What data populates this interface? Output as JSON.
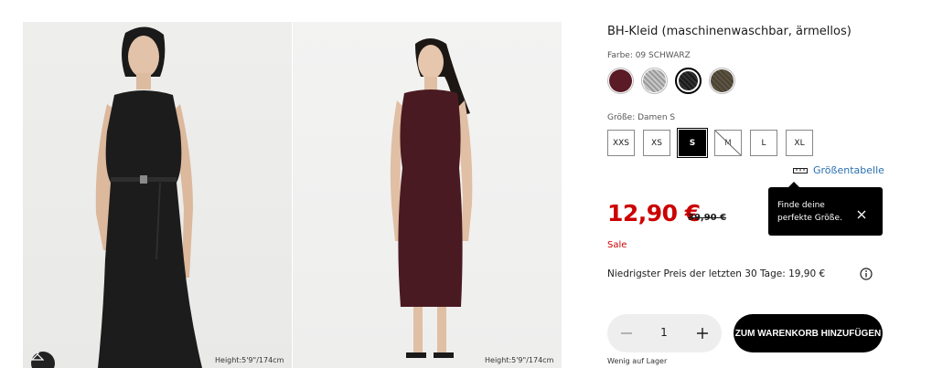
{
  "gallery": {
    "images": [
      {
        "caption": "Height:5'9\"/174cm",
        "dress_color": "#1c1c1c"
      },
      {
        "caption": "Height:5'9\"/174cm",
        "dress_color": "#4a1a22"
      }
    ],
    "hanger_icon": "hanger-icon"
  },
  "product": {
    "title": "BH-Kleid (maschinenwaschbar, ärmellos)",
    "color_label": "Farbe: 09 SCHWARZ",
    "swatches": [
      {
        "color": "#5a1a26",
        "selected": false
      },
      {
        "color": "#9a9a9a",
        "selected": false
      },
      {
        "color": "#1a1a1a",
        "selected": true
      },
      {
        "color": "#4a4234",
        "selected": false
      }
    ],
    "size_label": "Größe: Damen S",
    "sizes": [
      {
        "label": "XXS",
        "state": "available"
      },
      {
        "label": "XS",
        "state": "available"
      },
      {
        "label": "S",
        "state": "selected"
      },
      {
        "label": "M",
        "state": "unavailable"
      },
      {
        "label": "L",
        "state": "available"
      },
      {
        "label": "XL",
        "state": "available"
      }
    ],
    "size_chart_label": "Größentabelle",
    "price": "12,90 €",
    "old_price": "39,90 €",
    "sale_label": "Sale",
    "tooltip": {
      "text": "Finde deine perfekte Größe."
    },
    "lowest_price": "Niedrigster Preis der letzten 30 Tage: 19,90 €",
    "quantity": "1",
    "add_to_cart": "ZUM WARENKORB HINZUFÜGEN",
    "stock": "Wenig auf Lager"
  },
  "colors": {
    "sale_red": "#cc0000",
    "link_blue": "#2a6fae"
  }
}
